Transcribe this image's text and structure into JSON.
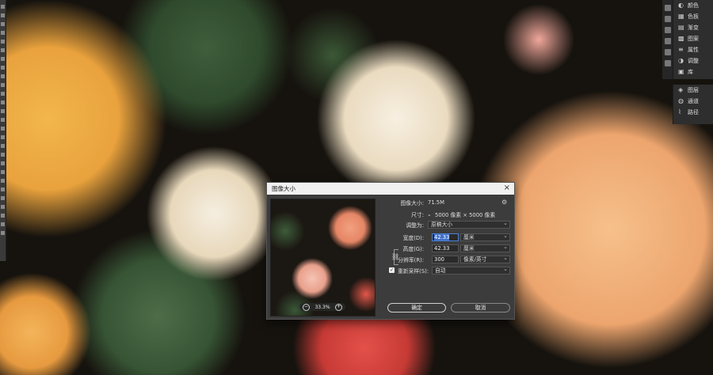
{
  "right_panel": {
    "group1": [
      {
        "icon": "palette-icon",
        "label": "颜色"
      },
      {
        "icon": "swatches-icon",
        "label": "色板"
      },
      {
        "icon": "gradient-icon",
        "label": "渐变"
      },
      {
        "icon": "pattern-icon",
        "label": "图案"
      },
      {
        "icon": "properties-icon",
        "label": "属性"
      },
      {
        "icon": "adjustments-icon",
        "label": "调整"
      },
      {
        "icon": "library-icon",
        "label": "库"
      }
    ],
    "group2": [
      {
        "icon": "layers-icon",
        "label": "图层"
      },
      {
        "icon": "channels-icon",
        "label": "通道"
      },
      {
        "icon": "paths-icon",
        "label": "路径"
      }
    ]
  },
  "dialog": {
    "title": "图像大小",
    "close": "×",
    "preview": {
      "zoom": "33.3%",
      "zoom_out": "−",
      "zoom_in": "+"
    },
    "image_size_label": "图像大小:",
    "image_size_value": "71.5M",
    "dimensions_label": "尺寸:",
    "dimensions_value": "5000 像素 × 5000 像素",
    "fit_label": "调整为:",
    "fit_value": "原稿大小",
    "width_label": "宽度(D):",
    "width_value": "42.33",
    "width_unit": "厘米",
    "height_label": "高度(G):",
    "height_value": "42.33",
    "height_unit": "厘米",
    "resolution_label": "分辨率(R):",
    "resolution_value": "300",
    "resolution_unit": "像素/英寸",
    "resample_label": "重新采样(S):",
    "resample_checked": true,
    "resample_value": "自动",
    "ok_label": "确定",
    "cancel_label": "取消"
  }
}
